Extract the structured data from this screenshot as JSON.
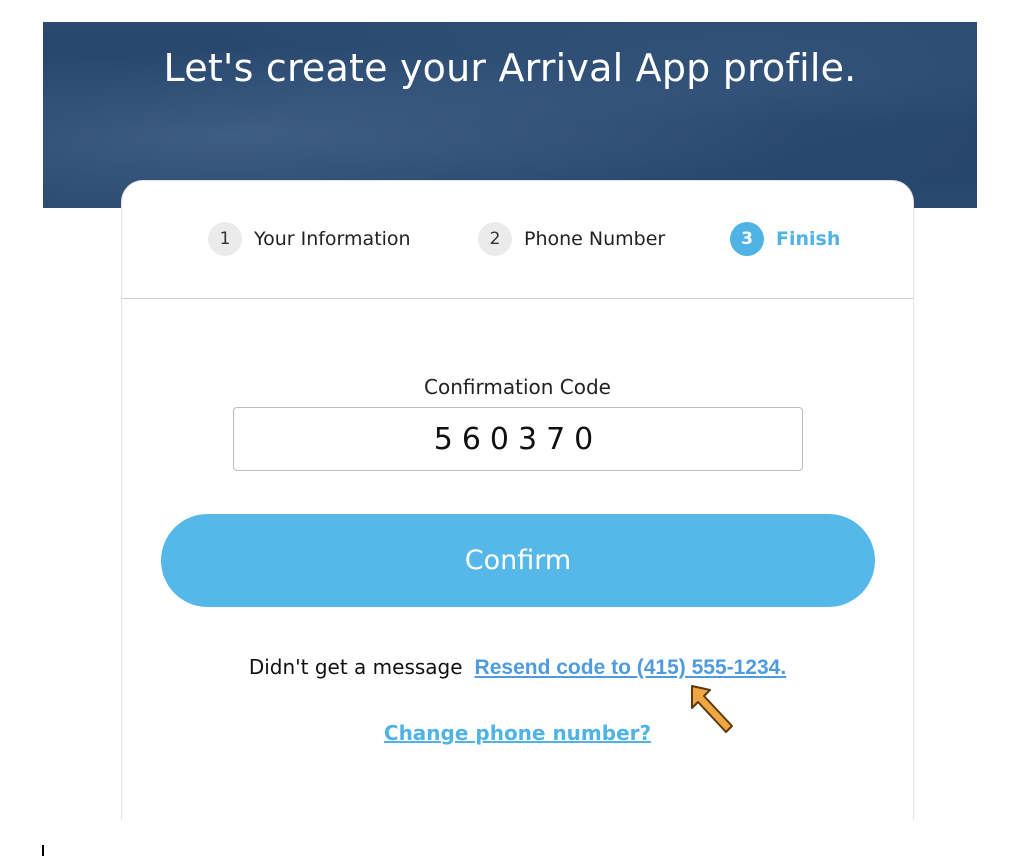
{
  "hero": {
    "title": "Let's create your Arrival App profile."
  },
  "steps": [
    {
      "number": "1",
      "label": "Your Information",
      "active": false
    },
    {
      "number": "2",
      "label": "Phone Number",
      "active": false
    },
    {
      "number": "3",
      "label": "Finish",
      "active": true
    }
  ],
  "form": {
    "code_label": "Confirmation Code",
    "code_value": "560370",
    "confirm_label": "Confirm"
  },
  "resend": {
    "prompt": "Didn't get a message",
    "link": "Resend code to (415) 555-1234."
  },
  "change_phone_link": "Change phone number?",
  "colors": {
    "accent": "#4fb3e6",
    "button": "#55b8e8",
    "hero_bg": "#1f3e66",
    "annotation_arrow": "#f2a641"
  },
  "icons": {
    "annotation": "arrow-up-left-icon"
  }
}
